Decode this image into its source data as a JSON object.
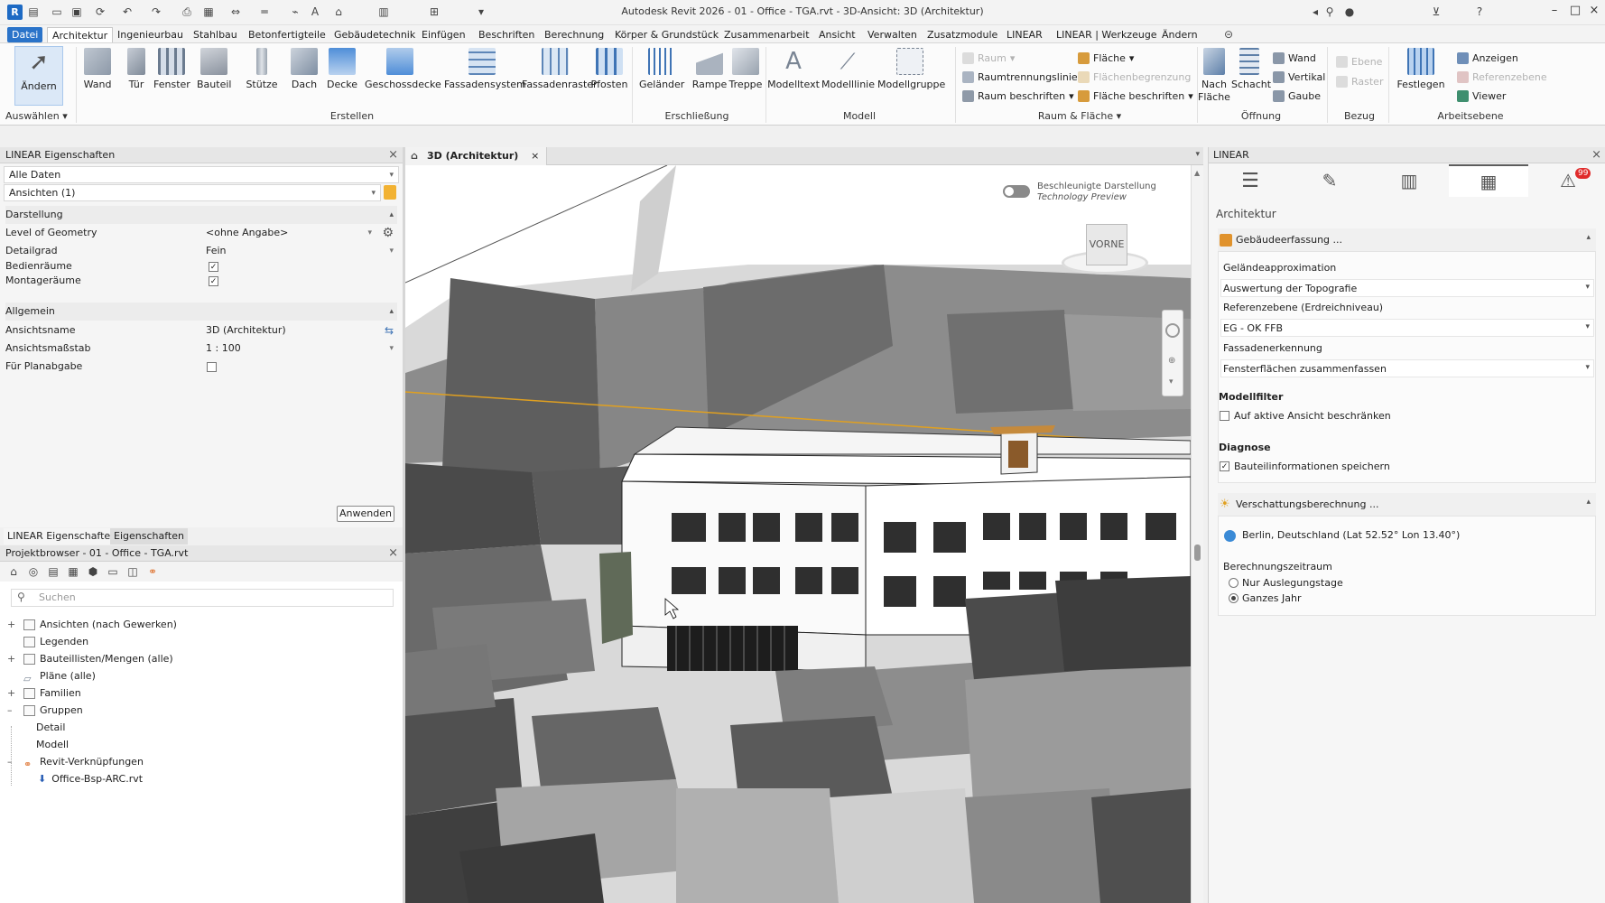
{
  "window": {
    "title": "Autodesk Revit 2026 - 01 - Office - TGA.rvt - 3D-Ansicht: 3D (Architektur)",
    "app_icon_letter": "R"
  },
  "menu": {
    "tabs": [
      "Datei",
      "Architektur",
      "Ingenieurbau",
      "Stahlbau",
      "Betonfertigteile",
      "Gebäudetechnik",
      "Einfügen",
      "Beschriften",
      "Berechnung",
      "Körper & Grundstück",
      "Zusammenarbeit",
      "Ansicht",
      "Verwalten",
      "Zusatzmodule",
      "LINEAR",
      "LINEAR | Werkzeuge",
      "Ändern"
    ]
  },
  "ribbon": {
    "buttons": [
      "Ändern",
      "Wand",
      "Tür",
      "Fenster",
      "Bauteil",
      "Stütze",
      "Dach",
      "Decke",
      "Geschossdecke",
      "Fassadensystem",
      "Fassadenraster",
      "Pfosten",
      "Geländer",
      "Rampe",
      "Treppe",
      "Modelltext",
      "Modelllinie",
      "Modellgruppe"
    ],
    "select_label": "Auswählen",
    "groups": [
      "Erstellen",
      "Erschließung",
      "Modell",
      "Raum & Fläche",
      "Öffnung",
      "Bezug",
      "Arbeitsebene"
    ],
    "raum_items": [
      "Raum",
      "Raumtrennungslinie",
      "Raum beschriften",
      "Fläche",
      "Flächenbegrenzung",
      "Fläche beschriften"
    ],
    "opening_items": [
      "Nach Fläche",
      "Schacht",
      "Wand",
      "Vertikal",
      "Gaube"
    ],
    "bezug_items": [
      "Ebene",
      "Raster"
    ],
    "work_items": [
      "Festlegen",
      "Anzeigen",
      "Referenzebene",
      "Viewer"
    ]
  },
  "properties": {
    "title": "LINEAR Eigenschaften",
    "filter": "Alle Daten",
    "view_selector": "Ansichten (1)",
    "sections": {
      "display": "Darstellung",
      "general": "Allgemein"
    },
    "rows": {
      "lod_label": "Level of Geometry",
      "lod_value": "<ohne Angabe>",
      "detail_label": "Detailgrad",
      "detail_value": "Fein",
      "bedien_label": "Bedienräume",
      "montage_label": "Montageräume",
      "name_label": "Ansichtsname",
      "name_value": "3D (Architektur)",
      "scale_label": "Ansichtsmaßstab",
      "scale_value": "1 : 100",
      "plan_label": "Für Planabgabe"
    },
    "apply_label": "Anwenden",
    "bottom_tabs": [
      "LINEAR Eigenschaften",
      "Eigenschaften"
    ]
  },
  "browser": {
    "title": "Projektbrowser - 01 - Office - TGA.rvt",
    "search_placeholder": "Suchen",
    "items": [
      "Ansichten (nach Gewerken)",
      "Legenden",
      "Bauteillisten/Mengen (alle)",
      "Pläne (alle)",
      "Familien",
      "Gruppen",
      "Detail",
      "Modell",
      "Revit-Verknüpfungen",
      "Office-Bsp-ARC.rvt"
    ]
  },
  "view": {
    "tab_label": "3D (Architektur)",
    "toggle_label": "Beschleunigte Darstellung",
    "toggle_sub": "Technology Preview",
    "cube_label": "VORNE"
  },
  "linear_panel": {
    "title": "LINEAR",
    "badge": "99",
    "category": "Architektur",
    "section1": "Gebäudeerfassung ...",
    "geo_approx": "Geländeapproximation",
    "topo_select": "Auswertung der Topografie",
    "ref_level_label": "Referenzebene (Erdreichniveau)",
    "ref_level_select": "EG - OK FFB",
    "facade_label": "Fassadenerkennung",
    "facade_select": "Fensterflächen zusammenfassen",
    "model_filter": "Modellfilter",
    "restrict_label": "Auf aktive Ansicht beschränken",
    "diagnosis": "Diagnose",
    "save_info_label": "Bauteilinformationen speichern",
    "section2": "Verschattungsberechnung ...",
    "location": "Berlin, Deutschland (Lat 52.52°  Lon 13.40°)",
    "period_label": "Berechnungszeitraum",
    "radio1": "Nur Auslegungstage",
    "radio2": "Ganzes Jahr"
  },
  "colors": {
    "accent": "#2a73c9",
    "building_dark": "#595959",
    "building_light": "#a8a8a8",
    "highlight_line": "#e0a020"
  }
}
